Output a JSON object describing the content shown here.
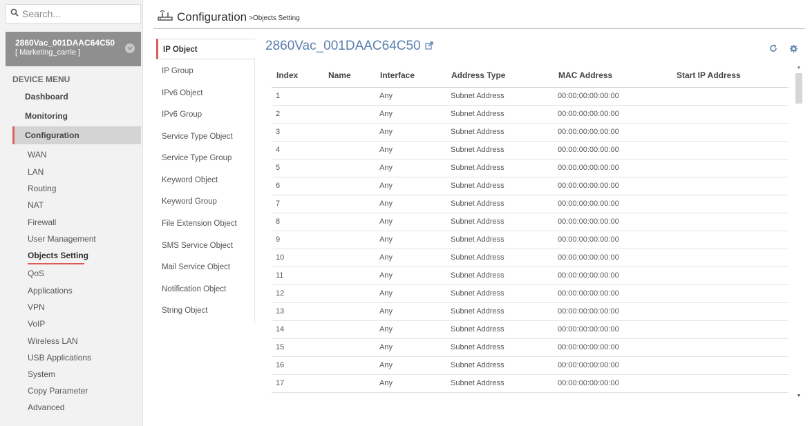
{
  "search": {
    "placeholder": "Search..."
  },
  "device": {
    "name": "2860Vac_001DAAC64C50",
    "user": "[ Marketing_carrie ]"
  },
  "menu": {
    "title": "DEVICE MENU",
    "main": [
      {
        "label": "Dashboard"
      },
      {
        "label": "Monitoring"
      },
      {
        "label": "Configuration",
        "active": true
      }
    ],
    "sub": [
      {
        "label": "WAN"
      },
      {
        "label": "LAN"
      },
      {
        "label": "Routing"
      },
      {
        "label": "NAT"
      },
      {
        "label": "Firewall"
      },
      {
        "label": "User Management"
      },
      {
        "label": "Objects Setting",
        "active": true
      },
      {
        "label": "QoS"
      },
      {
        "label": "Applications"
      },
      {
        "label": "VPN"
      },
      {
        "label": "VoIP"
      },
      {
        "label": "Wireless LAN"
      },
      {
        "label": "USB Applications"
      },
      {
        "label": "System"
      },
      {
        "label": "Copy Parameter"
      },
      {
        "label": "Advanced"
      }
    ]
  },
  "header": {
    "title": "Configuration",
    "breadcrumb": ">Objects Setting"
  },
  "objects": [
    {
      "label": "IP Object",
      "active": true
    },
    {
      "label": "IP Group"
    },
    {
      "label": "IPv6 Object"
    },
    {
      "label": "IPv6 Group"
    },
    {
      "label": "Service Type Object"
    },
    {
      "label": "Service Type Group"
    },
    {
      "label": "Keyword Object"
    },
    {
      "label": "Keyword Group"
    },
    {
      "label": "File Extension Object"
    },
    {
      "label": "SMS Service Object"
    },
    {
      "label": "Mail Service Object"
    },
    {
      "label": "Notification Object"
    },
    {
      "label": "String Object"
    }
  ],
  "panel": {
    "title": "2860Vac_001DAAC64C50"
  },
  "table": {
    "columns": [
      "Index",
      "Name",
      "Interface",
      "Address Type",
      "MAC Address",
      "Start IP Address"
    ],
    "rows": [
      [
        "1",
        "",
        "Any",
        "Subnet Address",
        "00:00:00:00:00:00",
        ""
      ],
      [
        "2",
        "",
        "Any",
        "Subnet Address",
        "00:00:00:00:00:00",
        ""
      ],
      [
        "3",
        "",
        "Any",
        "Subnet Address",
        "00:00:00:00:00:00",
        ""
      ],
      [
        "4",
        "",
        "Any",
        "Subnet Address",
        "00:00:00:00:00:00",
        ""
      ],
      [
        "5",
        "",
        "Any",
        "Subnet Address",
        "00:00:00:00:00:00",
        ""
      ],
      [
        "6",
        "",
        "Any",
        "Subnet Address",
        "00:00:00:00:00:00",
        ""
      ],
      [
        "7",
        "",
        "Any",
        "Subnet Address",
        "00:00:00:00:00:00",
        ""
      ],
      [
        "8",
        "",
        "Any",
        "Subnet Address",
        "00:00:00:00:00:00",
        ""
      ],
      [
        "9",
        "",
        "Any",
        "Subnet Address",
        "00:00:00:00:00:00",
        ""
      ],
      [
        "10",
        "",
        "Any",
        "Subnet Address",
        "00:00:00:00:00:00",
        ""
      ],
      [
        "11",
        "",
        "Any",
        "Subnet Address",
        "00:00:00:00:00:00",
        ""
      ],
      [
        "12",
        "",
        "Any",
        "Subnet Address",
        "00:00:00:00:00:00",
        ""
      ],
      [
        "13",
        "",
        "Any",
        "Subnet Address",
        "00:00:00:00:00:00",
        ""
      ],
      [
        "14",
        "",
        "Any",
        "Subnet Address",
        "00:00:00:00:00:00",
        ""
      ],
      [
        "15",
        "",
        "Any",
        "Subnet Address",
        "00:00:00:00:00:00",
        ""
      ],
      [
        "16",
        "",
        "Any",
        "Subnet Address",
        "00:00:00:00:00:00",
        ""
      ],
      [
        "17",
        "",
        "Any",
        "Subnet Address",
        "00:00:00:00:00:00",
        ""
      ]
    ]
  },
  "icons": {
    "search": "search-icon",
    "device_toggle": "chevron-down-icon",
    "configuration": "router-icon",
    "external": "external-link-icon",
    "refresh": "refresh-icon",
    "settings": "gear-icon"
  },
  "colors": {
    "accent": "#e05a5a",
    "title_blue": "#5a7fae",
    "device_bg": "#8f8f8f"
  }
}
